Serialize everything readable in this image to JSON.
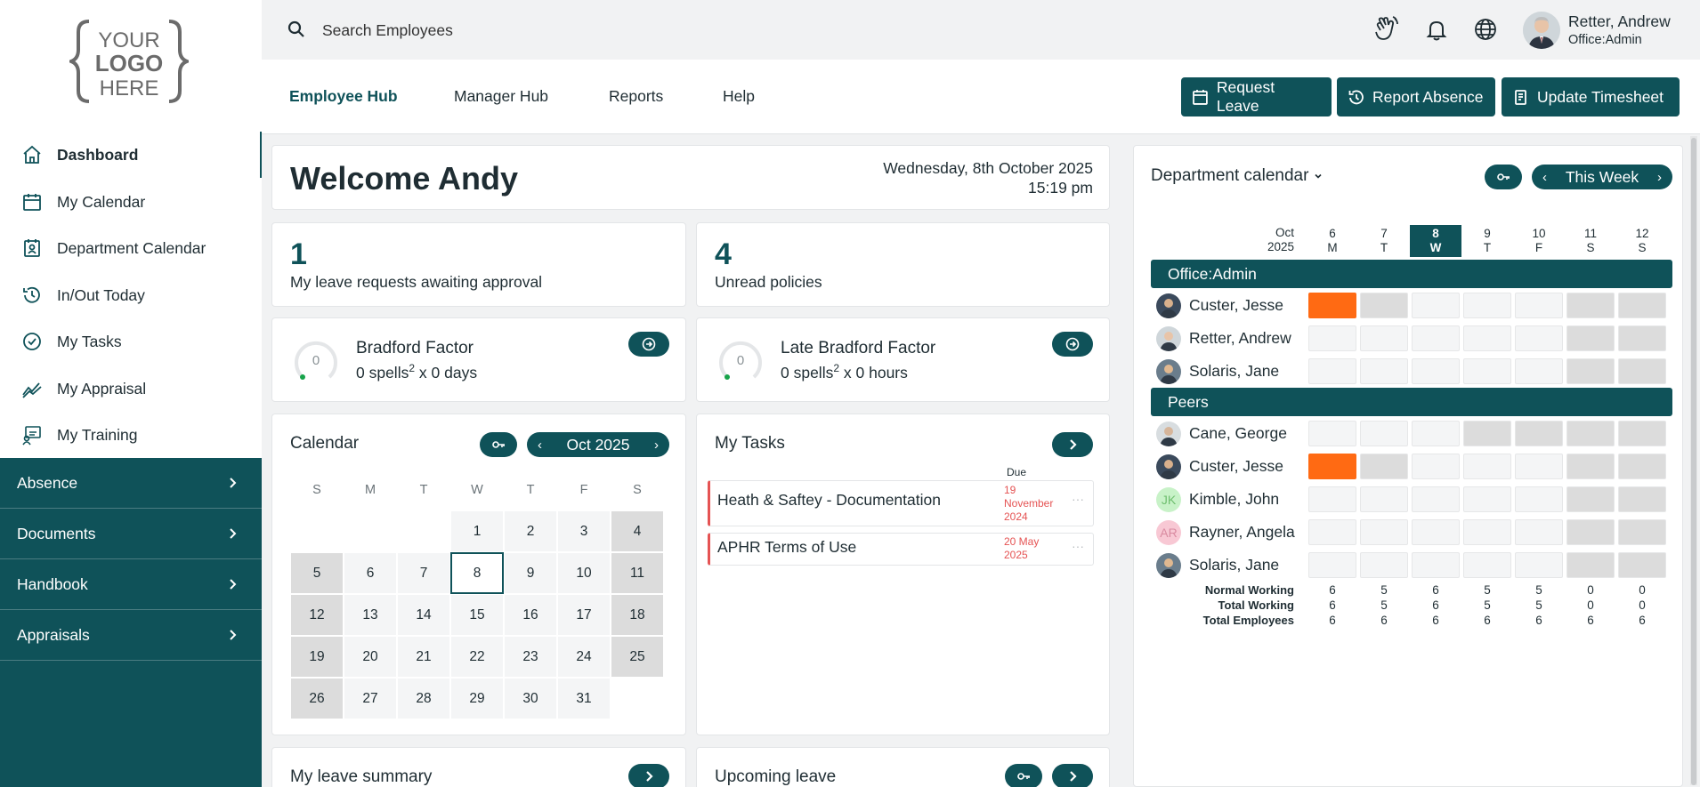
{
  "logo": {
    "line1": "YOUR",
    "line2": "LOGO",
    "line3": "HERE"
  },
  "sidebar": {
    "items": [
      {
        "label": "Dashboard",
        "icon": "home-icon"
      },
      {
        "label": "My Calendar",
        "icon": "calendar-icon"
      },
      {
        "label": "Department Calendar",
        "icon": "department-calendar-icon"
      },
      {
        "label": "In/Out Today",
        "icon": "clock-icon"
      },
      {
        "label": "My Tasks",
        "icon": "check-circle-icon"
      },
      {
        "label": "My Appraisal",
        "icon": "trend-icon"
      },
      {
        "label": "My Training",
        "icon": "training-icon"
      }
    ],
    "sections": [
      "Absence",
      "Documents",
      "Handbook",
      "Appraisals"
    ]
  },
  "topbar": {
    "search_placeholder": "Search Employees",
    "user_name": "Retter, Andrew",
    "user_role": "Office:Admin"
  },
  "subnav": {
    "tabs": [
      "Employee Hub",
      "Manager Hub",
      "Reports",
      "Help"
    ],
    "actions": [
      "Request Leave",
      "Report Absence",
      "Update Timesheet"
    ]
  },
  "welcome": {
    "title": "Welcome Andy",
    "date": "Wednesday, 8th October 2025",
    "time": "15:19 pm"
  },
  "stats": [
    {
      "value": "1",
      "label": "My leave requests awaiting approval"
    },
    {
      "value": "4",
      "label": "Unread policies"
    }
  ],
  "bradford": [
    {
      "title": "Bradford Factor",
      "gauge": "0",
      "sub_a": "0 spells",
      "sup": "2",
      "sub_b": " x 0 days"
    },
    {
      "title": "Late Bradford Factor",
      "gauge": "0",
      "sub_a": "0 spells",
      "sup": "2",
      "sub_b": " x 0 hours"
    }
  ],
  "calendar": {
    "title": "Calendar",
    "month": "Oct 2025",
    "weekdays": [
      "S",
      "M",
      "T",
      "W",
      "T",
      "F",
      "S"
    ],
    "days": [
      "1",
      "2",
      "3",
      "4",
      "5",
      "6",
      "7",
      "8",
      "9",
      "10",
      "11",
      "12",
      "13",
      "14",
      "15",
      "16",
      "17",
      "18",
      "19",
      "20",
      "21",
      "22",
      "23",
      "24",
      "25",
      "26",
      "27",
      "28",
      "29",
      "30",
      "31"
    ],
    "today": "8"
  },
  "tasks": {
    "title": "My Tasks",
    "due_header": "Due",
    "items": [
      {
        "name": "Heath & Saftey - Documentation",
        "due": "19 November 2024"
      },
      {
        "name": "APHR Terms of Use",
        "due": "20 May 2025"
      }
    ]
  },
  "leave_summary": {
    "title": "My leave summary"
  },
  "upcoming_leave": {
    "title": "Upcoming leave"
  },
  "dept_calendar": {
    "title": "Department calendar",
    "range": "This Week",
    "month_label": "Oct",
    "year_label": "2025",
    "days": [
      {
        "num": "6",
        "dow": "M"
      },
      {
        "num": "7",
        "dow": "T"
      },
      {
        "num": "8",
        "dow": "W"
      },
      {
        "num": "9",
        "dow": "T"
      },
      {
        "num": "10",
        "dow": "F"
      },
      {
        "num": "11",
        "dow": "S"
      },
      {
        "num": "12",
        "dow": "S"
      }
    ],
    "groups": [
      {
        "name": "Office:Admin",
        "employees": [
          {
            "name": "Custer, Jesse",
            "initials": "",
            "leave_days": [
              "6"
            ],
            "off_days": [
              "7"
            ]
          },
          {
            "name": "Retter, Andrew",
            "initials": "",
            "leave_days": [],
            "off_days": []
          },
          {
            "name": "Solaris, Jane",
            "initials": "",
            "leave_days": [],
            "off_days": []
          }
        ]
      },
      {
        "name": "Peers",
        "employees": [
          {
            "name": "Cane, George",
            "initials": "",
            "leave_days": [],
            "off_days": [
              "9",
              "10"
            ]
          },
          {
            "name": "Custer, Jesse",
            "initials": "",
            "leave_days": [
              "6"
            ],
            "off_days": [
              "7"
            ]
          },
          {
            "name": "Kimble, John",
            "initials": "JK",
            "leave_days": [],
            "off_days": []
          },
          {
            "name": "Rayner, Angela",
            "initials": "AR",
            "leave_days": [],
            "off_days": []
          },
          {
            "name": "Solaris, Jane",
            "initials": "",
            "leave_days": [],
            "off_days": []
          }
        ]
      }
    ],
    "summary": [
      {
        "label": "Normal Working",
        "values": [
          "6",
          "5",
          "6",
          "5",
          "5",
          "0",
          "0"
        ]
      },
      {
        "label": "Total Working",
        "values": [
          "6",
          "5",
          "6",
          "5",
          "5",
          "0",
          "0"
        ]
      },
      {
        "label": "Total Employees",
        "values": [
          "6",
          "6",
          "6",
          "6",
          "6",
          "6",
          "6"
        ]
      }
    ]
  },
  "colors": {
    "primary": "#0f5259",
    "leave": "#ff6a13",
    "weekend": "#dcdcdc",
    "due": "#e55353"
  }
}
